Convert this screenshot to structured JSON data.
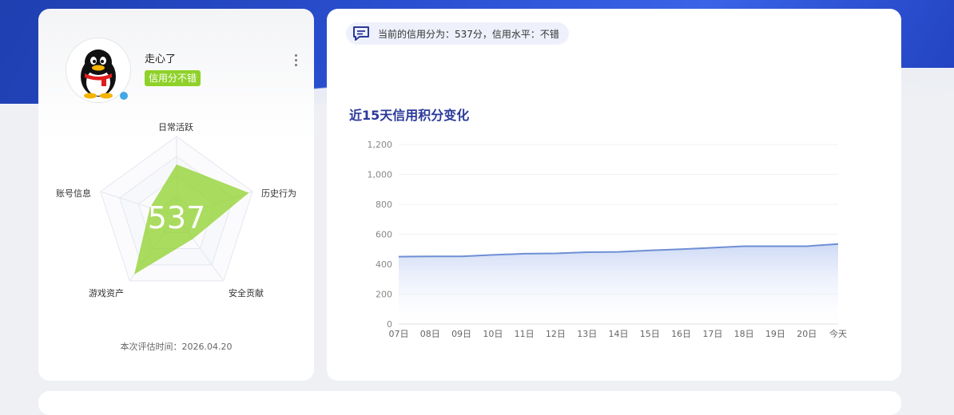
{
  "profile": {
    "username": "走心了",
    "badge": "信用分不错",
    "radar_labels": [
      "日常活跃",
      "历史行为",
      "安全贡献",
      "游戏资产",
      "账号信息"
    ],
    "radar_values": [
      0.65,
      0.95,
      0.35,
      0.9,
      0.35
    ],
    "score": "537",
    "eval_time": "本次评估时间：2026.04.20",
    "accent": "#8fd12a"
  },
  "notice": {
    "text": "当前的信用分为：537分，信用水平：不错"
  },
  "chart": {
    "title": "近15天信用积分变化"
  },
  "chart_data": {
    "type": "area",
    "title": "近15天信用积分变化",
    "categories": [
      "07日",
      "08日",
      "09日",
      "10日",
      "11日",
      "12日",
      "13日",
      "14日",
      "15日",
      "16日",
      "17日",
      "18日",
      "19日",
      "20日",
      "今天"
    ],
    "values": [
      450,
      452,
      452,
      462,
      470,
      472,
      480,
      482,
      492,
      500,
      510,
      520,
      520,
      520,
      535
    ],
    "ylim": [
      0,
      1200
    ],
    "yticks": [
      0,
      200,
      400,
      600,
      800,
      1000,
      1200
    ],
    "ytick_labels": [
      "0",
      "200",
      "400",
      "600",
      "800",
      "1,000",
      "1,200"
    ],
    "grid": true,
    "color": "#6f8fd6"
  }
}
